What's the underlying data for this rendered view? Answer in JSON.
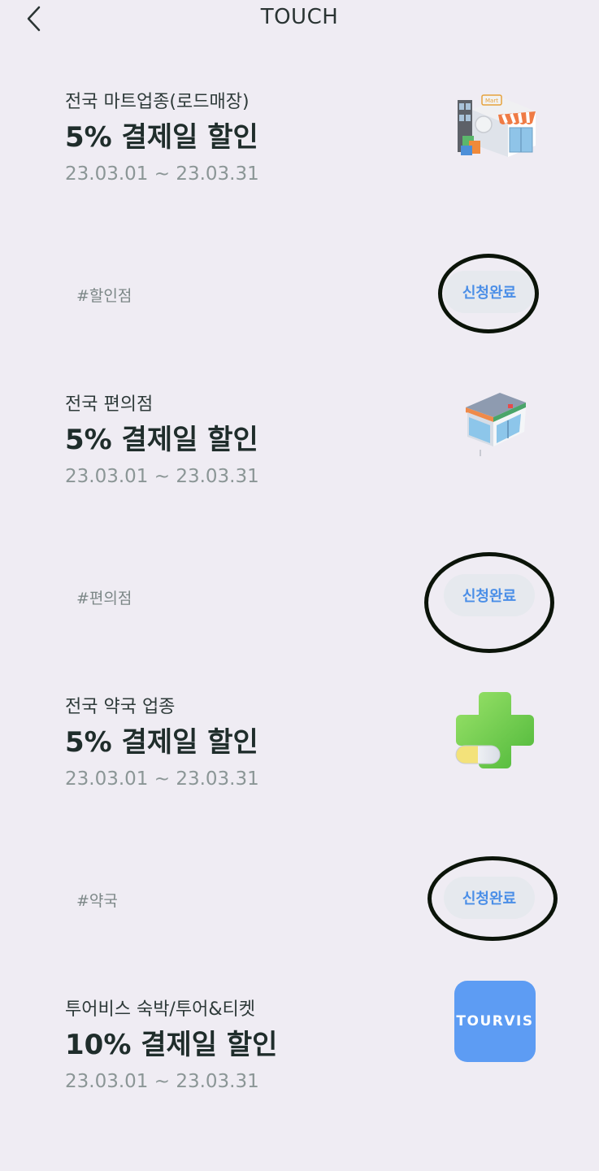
{
  "header": {
    "title": "TOUCH",
    "back_icon": "chevron-left-icon"
  },
  "offers": [
    {
      "category": "전국 마트업종(로드매장)",
      "headline": "5% 결제일 할인",
      "period": "23.03.01 ~ 23.03.31",
      "image": "mart-store-icon",
      "tag": "#할인점",
      "status": "신청완료"
    },
    {
      "category": "전국 편의점",
      "headline": "5% 결제일 할인",
      "period": "23.03.01 ~ 23.03.31",
      "image": "convenience-store-icon",
      "tag": "#편의점",
      "status": "신청완료"
    },
    {
      "category": "전국 약국 업종",
      "headline": "5% 결제일 할인",
      "period": "23.03.01 ~ 23.03.31",
      "image": "pharmacy-cross-pill-icon",
      "tag": "#약국",
      "status": "신청완료"
    },
    {
      "category": "투어비스 숙박/투어&티켓",
      "headline": "10% 결제일 할인",
      "period": "23.03.01 ~ 23.03.31",
      "image": "tourvis-logo",
      "logo_text": "TOURVIS"
    }
  ],
  "colors": {
    "background": "#efecf3",
    "accent": "#4a8ee7",
    "button_bg": "#e6e9ee",
    "tourvis_blue": "#5d9cf3",
    "annotation_ring": "#0b1409"
  }
}
